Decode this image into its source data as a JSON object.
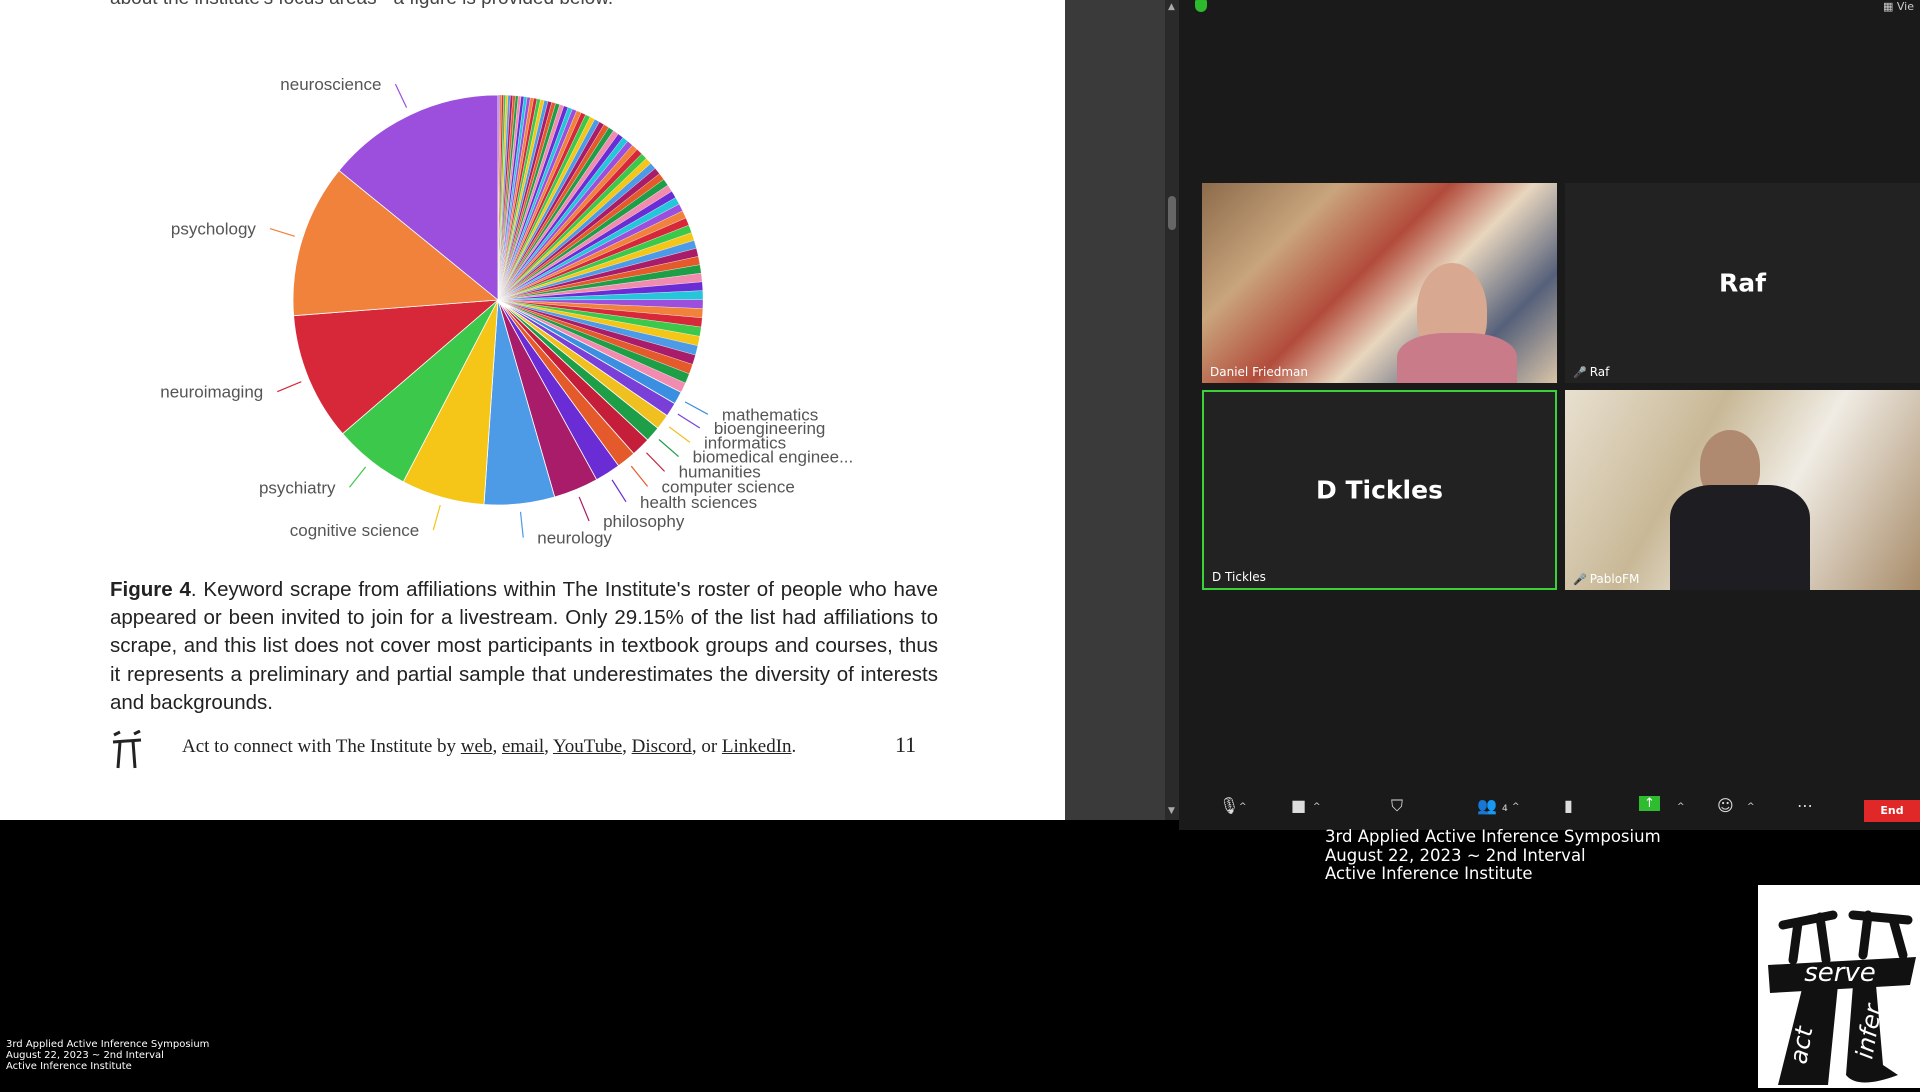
{
  "document": {
    "top_text": "about the institute's focus areas - a figure is provided below.",
    "figure_label": "Figure 4",
    "caption": ". Keyword scrape from affiliations within The Institute's roster of people who have appeared or been invited to join for a livestream. Only 29.15% of the list had affiliations to scrape, and this list does not cover most participants in textbook groups and courses, thus it represents a preliminary and partial sample that underestimates the diversity of interests and backgrounds.",
    "footer_prefix": "Act to connect with The Institute by",
    "footer_links": [
      "web",
      "email",
      "YouTube",
      "Discord",
      "LinkedIn"
    ],
    "footer_or": "or",
    "page_number": "11"
  },
  "chart_data": {
    "type": "pie",
    "labels": [
      "neuroscience",
      "psychology",
      "neuroimaging",
      "psychiatry",
      "cognitive science",
      "neurology",
      "philosophy",
      "health sciences",
      "computer science",
      "humanities",
      "biomedical enginee...",
      "informatics",
      "bioengineering",
      "mathematics"
    ],
    "values": [
      14,
      12,
      10,
      6,
      6.5,
      5.5,
      3.5,
      2,
      1.5,
      1.5,
      1.2,
      1.2,
      1.1,
      1
    ],
    "colors": [
      "#9b4fdc",
      "#f0823c",
      "#d62839",
      "#3cc84a",
      "#f5c518",
      "#4d9be6",
      "#a81c6a",
      "#6a2cd4",
      "#e45a2a",
      "#c41e3a",
      "#1f9e48",
      "#f0c020",
      "#7a3fd8",
      "#3a8fe0"
    ],
    "other_slices": 70
  },
  "zoom": {
    "participants": [
      {
        "name": "Daniel Friedman",
        "muted": false
      },
      {
        "name": "Raf",
        "display": "Raf",
        "muted": true
      },
      {
        "name": "D Tickles",
        "display": "D Tickles",
        "muted": false
      },
      {
        "name": "PabloFM",
        "muted": true
      }
    ],
    "view_label": "Vie",
    "participant_count": "4",
    "end_label": "End"
  },
  "overlay": {
    "line1": "3rd Applied Active Inference Symposium",
    "line2": "August 22, 2023 ~ 2nd Interval",
    "line3": "Active Inference Institute"
  },
  "logo": {
    "word1": "serve",
    "word2": "act",
    "word3": "infer"
  }
}
